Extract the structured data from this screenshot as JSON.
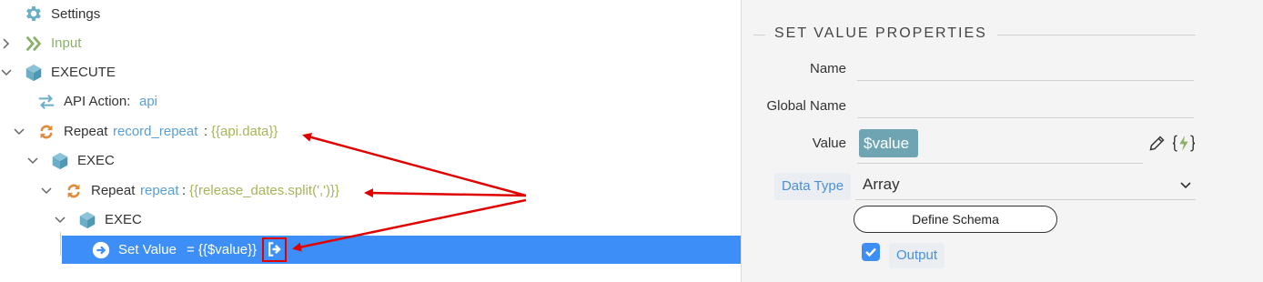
{
  "tree": {
    "settings": {
      "label": "Settings"
    },
    "input": {
      "label": "Input"
    },
    "execute": {
      "label": "EXECUTE"
    },
    "api_action": {
      "prefix": "API Action:",
      "name": "api"
    },
    "repeat1": {
      "prefix": "Repeat",
      "name": "record_repeat",
      "sep": ":",
      "expr": "{{api.data}}"
    },
    "exec1": {
      "label": "EXEC"
    },
    "repeat2": {
      "prefix": "Repeat",
      "name": "repeat",
      "sep": ":",
      "expr": "{{release_dates.split(',')}}"
    },
    "exec2": {
      "label": "EXEC"
    },
    "set_value": {
      "label": "Set Value",
      "expr": "= {{$value}}"
    }
  },
  "properties": {
    "title": "SET VALUE PROPERTIES",
    "name_label": "Name",
    "global_name_label": "Global Name",
    "value_label": "Value",
    "value_chip": "$value",
    "data_type_label": "Data Type",
    "data_type_value": "Array",
    "define_schema_label": "Define Schema",
    "output_label": "Output",
    "output_checked": true
  },
  "colors": {
    "selection": "#3d8ff7",
    "annotation_red": "#e00000",
    "value_chip": "#6fa5b2",
    "repeat_icon": "#e08a3c",
    "cube_icon": "#6aaec8"
  },
  "icons": {
    "settings": "gear-icon",
    "input": "double-chevron-right-icon",
    "execute": "cube-icon",
    "api_action": "swap-arrows-icon",
    "repeat": "repeat-icon",
    "set_value": "arrow-circle-right-icon",
    "output_marker": "exit-icon",
    "edit": "pencil-icon",
    "expression": "lightning-braces-icon"
  }
}
